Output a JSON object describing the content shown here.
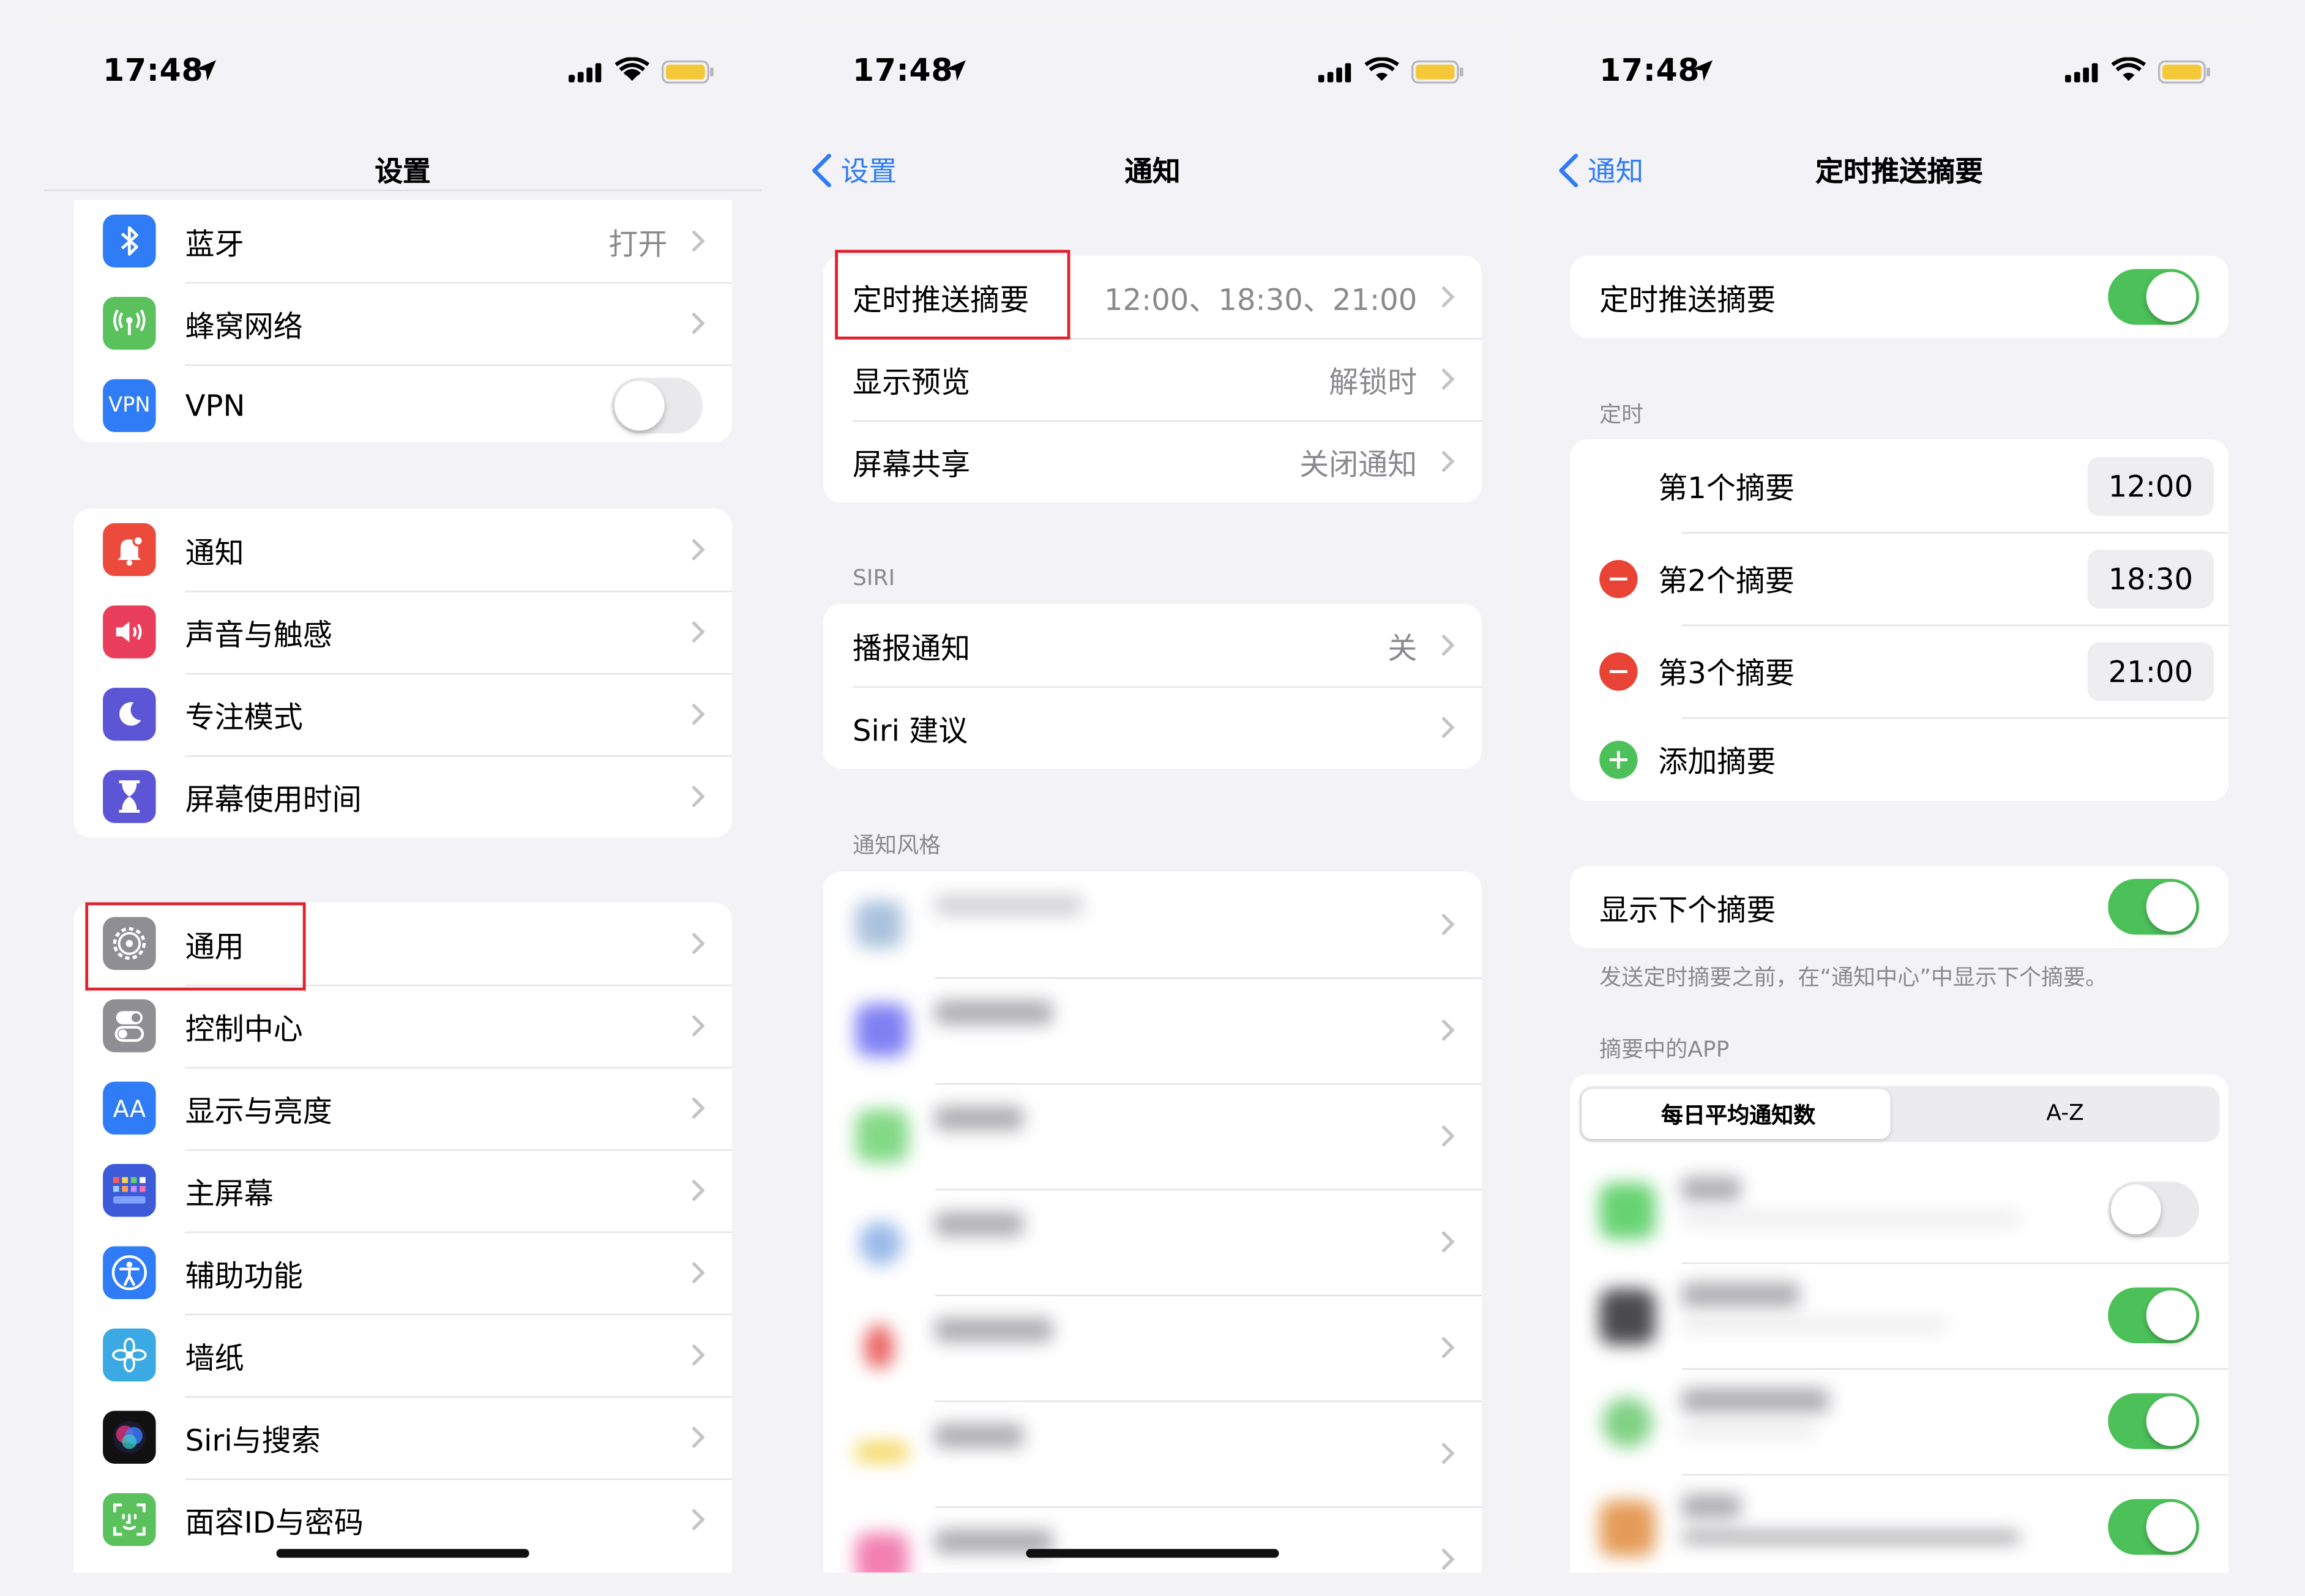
{
  "status": {
    "time": "17:48"
  },
  "colors": {
    "accent": "#2f7cf6",
    "toggle_on": "#4cc159",
    "highlight_box": "#e0222e"
  },
  "settings_screen": {
    "title": "设置",
    "group1": [
      {
        "label": "蓝牙",
        "value": "打开",
        "icon": "bluetooth-icon",
        "color": "#2f7cf6"
      },
      {
        "label": "蜂窝网络",
        "value": "",
        "icon": "cellular-icon",
        "color": "#5bc15d"
      },
      {
        "label": "VPN",
        "value": "",
        "icon": "vpn-icon",
        "color": "#2f7cf6",
        "icon_text": "VPN",
        "toggle": false
      }
    ],
    "group2": [
      {
        "label": "通知",
        "icon": "bell-icon",
        "color": "#ec4a3d"
      },
      {
        "label": "声音与触感",
        "icon": "speaker-icon",
        "color": "#e93e5b"
      },
      {
        "label": "专注模式",
        "icon": "moon-icon",
        "color": "#5c56d6"
      },
      {
        "label": "屏幕使用时间",
        "icon": "hourglass-icon",
        "color": "#5c56d6"
      }
    ],
    "group3": [
      {
        "label": "通用",
        "icon": "gear-icon",
        "color": "#8e8e93"
      },
      {
        "label": "控制中心",
        "icon": "switches-icon",
        "color": "#8e8e93"
      },
      {
        "label": "显示与亮度",
        "icon": "text-size-icon",
        "color": "#2f7cf6",
        "icon_text": "AA"
      },
      {
        "label": "主屏幕",
        "icon": "home-grid-icon",
        "color": "#3d5bd8"
      },
      {
        "label": "辅助功能",
        "icon": "accessibility-icon",
        "color": "#2f7cf6"
      },
      {
        "label": "墙纸",
        "icon": "flower-icon",
        "color": "#3aa9e4"
      },
      {
        "label": "Siri与搜索",
        "icon": "siri-icon",
        "color": "#222"
      },
      {
        "label": "面容ID与密码",
        "icon": "face-id-icon",
        "color": "#5bc15d"
      }
    ]
  },
  "notifications_screen": {
    "back": "设置",
    "title": "通知",
    "group1": [
      {
        "label": "定时推送摘要",
        "value": "12:00、18:30、21:00"
      },
      {
        "label": "显示预览",
        "value": "解锁时"
      },
      {
        "label": "屏幕共享",
        "value": "关闭通知"
      }
    ],
    "siri_header": "SIRI",
    "siri": [
      {
        "label": "播报通知",
        "value": "关"
      },
      {
        "label": "Siri 建议",
        "value": ""
      }
    ],
    "style_header": "通知风格"
  },
  "summary_screen": {
    "back": "通知",
    "title": "定时推送摘要",
    "toggle_label": "定时推送摘要",
    "toggle_on": true,
    "timing_header": "定时",
    "summaries": [
      {
        "label": "第1个摘要",
        "time": "12:00",
        "removable": false
      },
      {
        "label": "第2个摘要",
        "time": "18:30",
        "removable": true
      },
      {
        "label": "第3个摘要",
        "time": "21:00",
        "removable": true
      }
    ],
    "add_label": "添加摘要",
    "next_label": "显示下个摘要",
    "next_on": true,
    "next_desc": "发送定时摘要之前，在“通知中心”中显示下个摘要。",
    "apps_header": "摘要中的APP",
    "segments": [
      "每日平均通知数",
      "A-Z"
    ],
    "app_toggles": [
      false,
      true,
      true,
      true
    ]
  }
}
